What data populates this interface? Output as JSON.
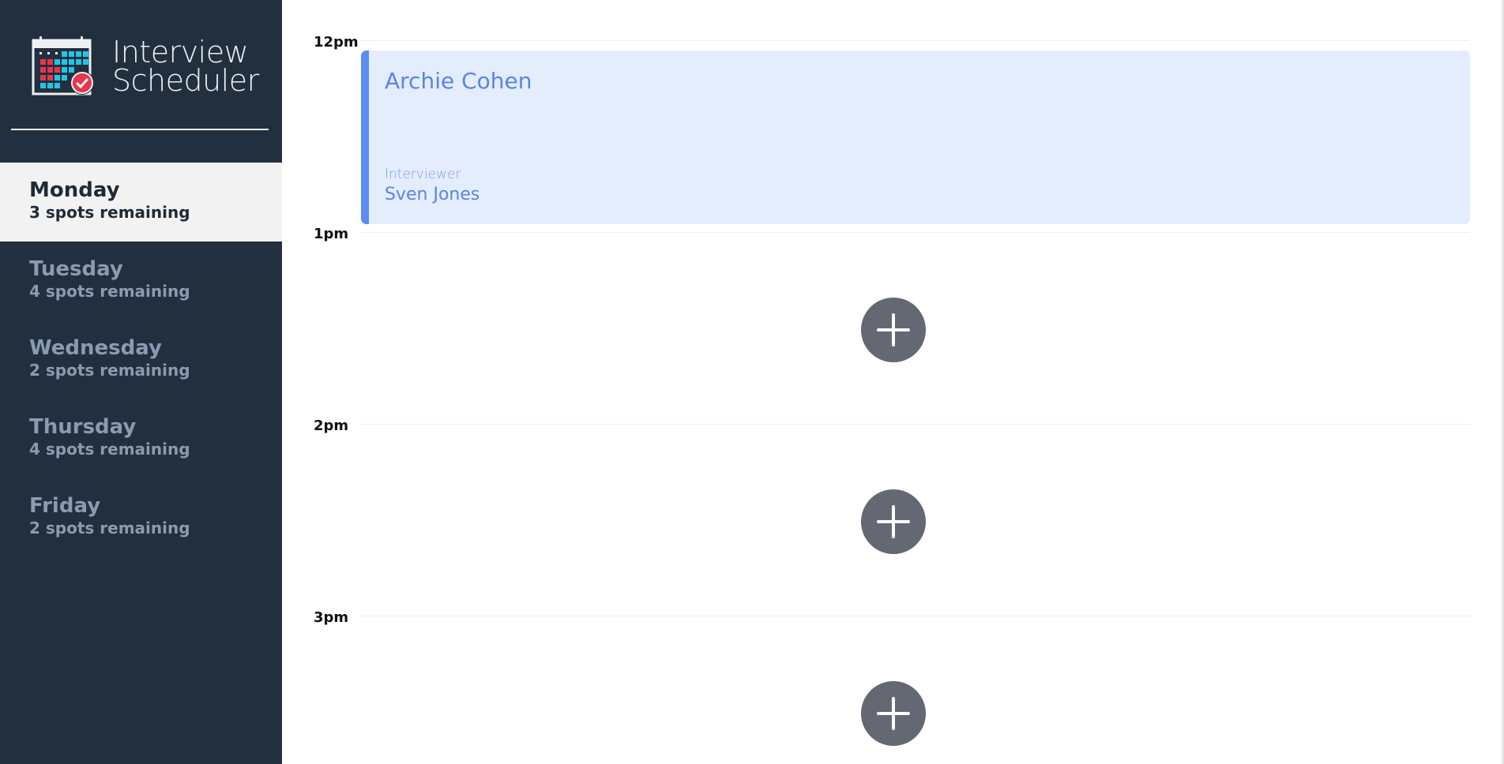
{
  "app": {
    "title_line1": "Interview",
    "title_line2": "Scheduler",
    "logo_icon": "calendar-check-icon"
  },
  "sidebar": {
    "days": [
      {
        "name": "Monday",
        "spots": "3 spots remaining",
        "selected": true
      },
      {
        "name": "Tuesday",
        "spots": "4 spots remaining",
        "selected": false
      },
      {
        "name": "Wednesday",
        "spots": "2 spots remaining",
        "selected": false
      },
      {
        "name": "Thursday",
        "spots": "4 spots remaining",
        "selected": false
      },
      {
        "name": "Friday",
        "spots": "2 spots remaining",
        "selected": false
      }
    ]
  },
  "schedule": {
    "slots": [
      {
        "time": "12pm",
        "appointment": {
          "student": "Archie Cohen",
          "interviewer_label": "Interviewer",
          "interviewer": "Sven Jones"
        }
      },
      {
        "time": "1pm",
        "add_icon": "plus-icon"
      },
      {
        "time": "2pm",
        "add_icon": "plus-icon"
      },
      {
        "time": "3pm",
        "add_icon": "plus-icon"
      }
    ]
  },
  "colors": {
    "sidebar_bg": "#222f3e",
    "selected_day_bg": "#f2f2f2",
    "appointment_bg": "#e4edfd",
    "appointment_accent": "#5c8cf0",
    "add_button_bg": "#636873"
  }
}
